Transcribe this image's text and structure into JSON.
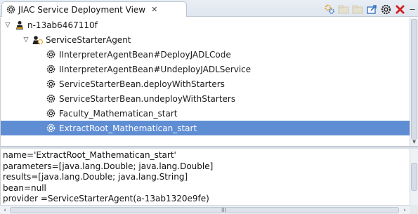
{
  "tab": {
    "title": "JIAC Service Deployment View",
    "close_glyph": "✕",
    "icon": "gear-icon"
  },
  "toolbar": {
    "buttons": [
      {
        "icon": "deploy-icon",
        "glyph": "⚙",
        "color": "#e0a020",
        "enabled": true
      },
      {
        "icon": "folder-icon",
        "glyph": "▭",
        "color": "#c9b070",
        "enabled": false
      },
      {
        "icon": "folder-icon",
        "glyph": "▭",
        "color": "#c9b070",
        "enabled": false
      },
      {
        "icon": "export-icon",
        "glyph": "↗",
        "color": "#3a74c4",
        "enabled": true
      },
      {
        "icon": "gear-icon",
        "glyph": "⚙",
        "color": "#333333",
        "enabled": true
      },
      {
        "icon": "remove-icon",
        "glyph": "✖",
        "color": "#d42020",
        "enabled": true
      }
    ],
    "minimize_glyph": "−"
  },
  "tree": {
    "rows": [
      {
        "label": "n-13ab6467110f",
        "level": 0,
        "expanded": true,
        "icon": "node-icon"
      },
      {
        "label": "ServiceStarterAgent",
        "level": 1,
        "expanded": true,
        "icon": "agent-icon"
      },
      {
        "label": "IInterpreterAgentBean#DeployJADLCode",
        "level": 2,
        "icon": "gear-icon"
      },
      {
        "label": "IInterpreterAgentBean#UndeployJADLService",
        "level": 2,
        "icon": "gear-icon"
      },
      {
        "label": "ServiceStarterBean.deployWithStarters",
        "level": 2,
        "icon": "gear-icon"
      },
      {
        "label": "ServiceStarterBean.undeployWithStarters",
        "level": 2,
        "icon": "gear-icon"
      },
      {
        "label": "Faculty_Mathematican_start",
        "level": 2,
        "icon": "gear-icon"
      },
      {
        "label": "ExtractRoot_Mathematican_start",
        "level": 2,
        "icon": "gear-icon",
        "selected": true
      }
    ],
    "twisty_expanded": "▽"
  },
  "details": {
    "lines": [
      "name='ExtractRoot_Mathematican_start'",
      "parameters=[java.lang.Double; java.lang.Double]",
      "results=[java.lang.Double; java.lang.String]",
      "bean=null",
      "provider =ServiceStarterAgent(a-13ab1320e9fe)"
    ]
  },
  "scrollbar": {
    "left_arrow": "‹",
    "right_arrow": "›",
    "grip": "III"
  },
  "colors": {
    "selection": "#5f8dd3",
    "tab_bar": "#e4eaf2"
  }
}
